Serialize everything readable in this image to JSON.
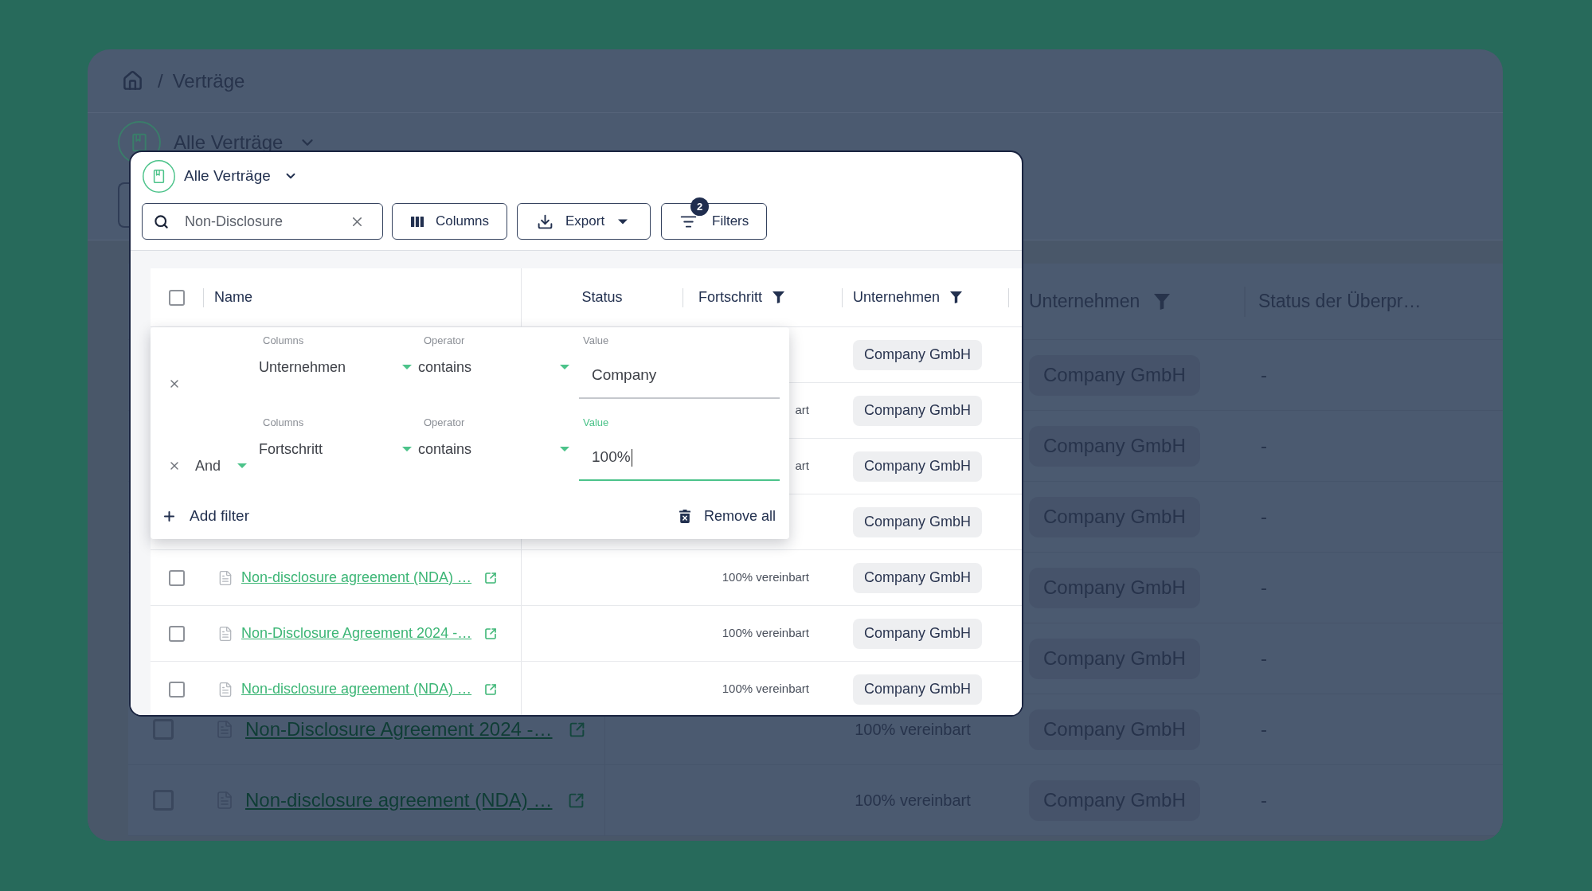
{
  "background": {
    "breadcrumb": {
      "separator": "/",
      "current": "Verträge"
    },
    "view": {
      "title": "Alle Verträge"
    },
    "table": {
      "columns": [
        {
          "label": "Unternehmen",
          "filtered": true
        },
        {
          "label": "Status der Überpr…",
          "filtered": false
        }
      ],
      "rows": [
        {
          "company": "Company GmbH",
          "status_der_ueberpr": "-"
        },
        {
          "company": "Company GmbH",
          "status_der_ueberpr": "-"
        },
        {
          "company": "Company GmbH",
          "status_der_ueberpr": "-"
        },
        {
          "company": "Company GmbH",
          "status_der_ueberpr": "-"
        },
        {
          "company": "Company GmbH",
          "status_der_ueberpr": "-"
        },
        {
          "checked": false,
          "name": "Non-Disclosure Agreement 2024 -…",
          "progress": "100% vereinbart",
          "company": "Company GmbH",
          "status_der_ueberpr": "-"
        },
        {
          "checked": false,
          "name": "Non-disclosure agreement (NDA) …",
          "progress": "100% vereinbart",
          "company": "Company GmbH",
          "status_der_ueberpr": "-"
        }
      ]
    }
  },
  "modal": {
    "view": {
      "title": "Alle Verträge"
    },
    "search": {
      "value": "Non-Disclosure"
    },
    "toolbar": [
      {
        "kind": "columns",
        "label": "Columns"
      },
      {
        "kind": "export",
        "label": "Export"
      },
      {
        "kind": "filters",
        "label": "Filters",
        "badge": "2"
      }
    ],
    "table": {
      "select_all_checked": false,
      "columns": [
        {
          "label": "Name",
          "filtered": false
        },
        {
          "label": "Status",
          "filtered": false
        },
        {
          "label": "Fortschritt",
          "filtered": true
        },
        {
          "label": "Unternehmen",
          "filtered": true
        }
      ],
      "rows": [
        {
          "company": "Company GmbH"
        },
        {
          "progress": "art",
          "company": "Company GmbH"
        },
        {
          "progress": "art",
          "company": "Company GmbH"
        },
        {
          "company": "Company GmbH"
        },
        {
          "checked": false,
          "name": "Non-disclosure agreement (NDA) …",
          "progress": "100% vereinbart",
          "company": "Company GmbH"
        },
        {
          "checked": false,
          "name": "Non-Disclosure Agreement 2024 -…",
          "progress": "100% vereinbart",
          "company": "Company GmbH"
        },
        {
          "checked": false,
          "name": "Non-disclosure agreement (NDA) …",
          "progress": "100% vereinbart",
          "company": "Company GmbH"
        }
      ]
    },
    "filter_panel": {
      "filters": [
        {
          "column_label": "Columns",
          "column": "Unternehmen",
          "operator_label": "Operator",
          "operator": "contains",
          "value_label": "Value",
          "value": "Company",
          "focused": false
        },
        {
          "logic": "And",
          "column_label": "Columns",
          "column": "Fortschritt",
          "operator_label": "Operator",
          "operator": "contains",
          "value_label": "Value",
          "value": "100%",
          "focused": true
        }
      ],
      "add_label": "Add filter",
      "remove_label": "Remove all"
    }
  }
}
